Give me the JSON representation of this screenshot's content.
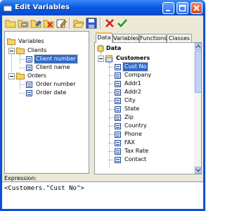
{
  "window": {
    "title": "Edit Variables"
  },
  "toolbar": {
    "icons": [
      "new-category-icon",
      "new-variable-icon",
      "edit-icon",
      "delete-icon",
      "edit-props-icon",
      "open-icon",
      "save-icon",
      "cancel-icon",
      "ok-icon"
    ]
  },
  "tree": {
    "root": "Variables",
    "groups": [
      {
        "label": "Clients",
        "items": [
          "Client number",
          "Client name"
        ]
      },
      {
        "label": "Orders",
        "items": [
          "Order number",
          "Order date"
        ]
      }
    ]
  },
  "tabs": [
    "Data",
    "Variables",
    "Functions",
    "Classes"
  ],
  "datalist": {
    "root": "Data",
    "table": "Customers",
    "fields": [
      "Cust No",
      "Company",
      "Addr1",
      "Addr2",
      "City",
      "State",
      "Zip",
      "Country",
      "Phone",
      "FAX",
      "Tax Rate",
      "Contact"
    ]
  },
  "expression": {
    "label": "Expression:",
    "value": "<Customers.\"Cust No\">"
  },
  "colors": {
    "title_bar": "#0a5ce6",
    "selection": "#316ac5",
    "dialog": "#ece9d8",
    "tab_highlight": "#f8b33c"
  }
}
